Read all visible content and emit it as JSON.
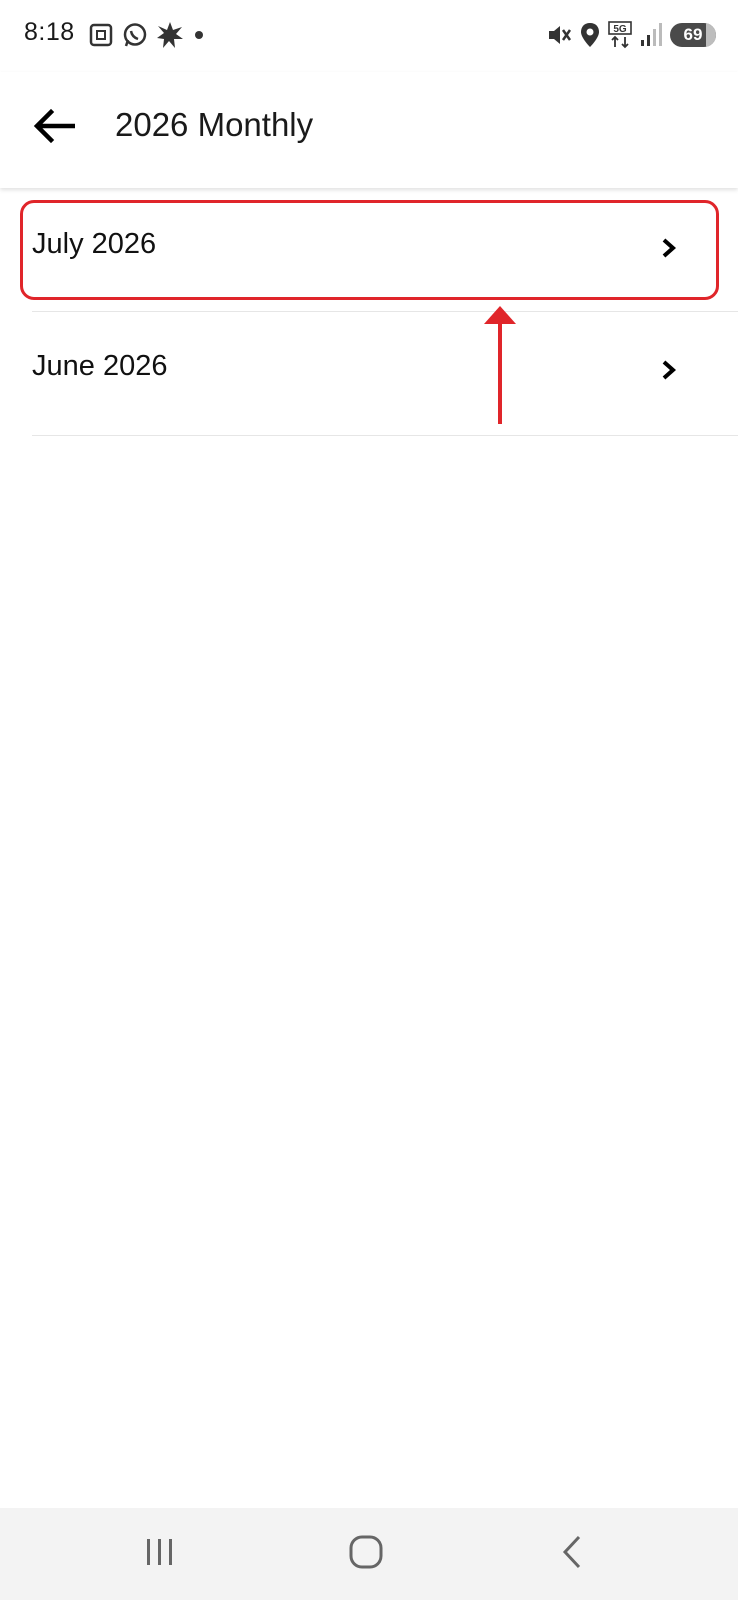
{
  "status_bar": {
    "time": "8:18",
    "battery_level": "69",
    "left_icons": [
      "screenshot-icon",
      "whatsapp-icon",
      "burst-icon",
      "dot-icon"
    ],
    "right_icons": [
      "mute-icon",
      "location-icon",
      "5g-icon",
      "signal-icon",
      "battery-icon"
    ]
  },
  "app_bar": {
    "title": "2026 Monthly",
    "back_icon": "arrow-left-icon"
  },
  "list": {
    "items": [
      {
        "label": "July 2026",
        "icon": "chevron-right-icon",
        "highlighted": true
      },
      {
        "label": "June 2026",
        "icon": "chevron-right-icon",
        "highlighted": false
      }
    ]
  },
  "annotation": {
    "color": "#e0252a",
    "type": "highlight-with-arrow"
  },
  "nav_bar": {
    "buttons": [
      "recent-apps-icon",
      "home-icon",
      "back-nav-icon"
    ]
  }
}
